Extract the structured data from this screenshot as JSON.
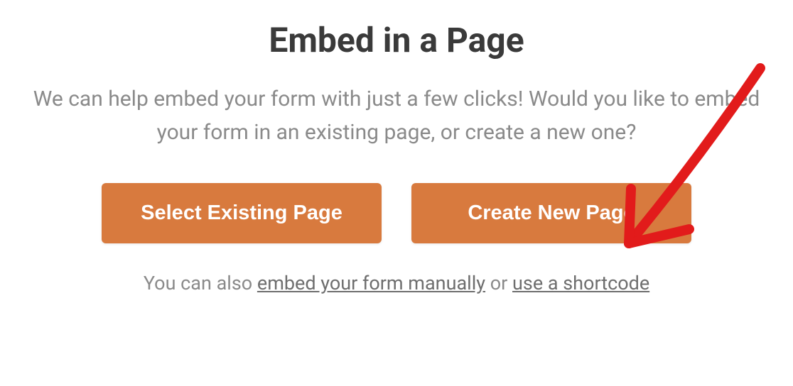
{
  "dialog": {
    "title": "Embed in a Page",
    "description": "We can help embed your form with just a few clicks! Would you like to embed your form in an existing page, or create a new one?",
    "buttons": {
      "select_existing": "Select Existing Page",
      "create_new": "Create New Page"
    },
    "footer": {
      "prefix": "You can also ",
      "link_manual": "embed your form manually",
      "conjunction": " or ",
      "link_shortcode": "use a shortcode"
    }
  },
  "annotation": {
    "type": "arrow",
    "color": "#e21b1b",
    "points_to": "create-new-page-button"
  }
}
